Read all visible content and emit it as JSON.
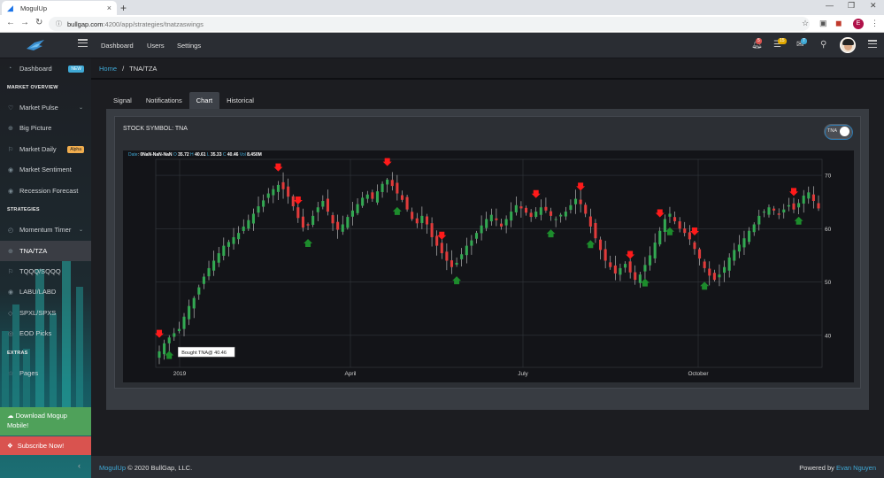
{
  "browser": {
    "tab_title": "MogulUp",
    "close_glyph": "×",
    "new_tab_glyph": "+",
    "url_host": "bullgap.com",
    "url_path": ":4200/app/strategies/tnatzaswings",
    "profile_initial": "E"
  },
  "header": {
    "nav": [
      "Dashboard",
      "Users",
      "Settings"
    ],
    "badges": {
      "notifications": "5",
      "messages": "15",
      "cart": "7"
    },
    "colors": {
      "notifications": "#d9534f",
      "messages": "#e0a800",
      "cart": "#3fa9d6"
    }
  },
  "sidebar": {
    "dashboard": {
      "label": "Dashboard",
      "badge": "NEW"
    },
    "sections": {
      "market_overview": "MARKET OVERVIEW",
      "strategies": "STRATEGIES",
      "extras": "EXTRAS"
    },
    "items": {
      "market_pulse": "Market Pulse",
      "big_picture": "Big Picture",
      "market_daily": "Market Daily",
      "market_daily_badge": "Alpha",
      "market_sentiment": "Market Sentiment",
      "recession_forecast": "Recession Forecast",
      "momentum_timer": "Momentum Timer",
      "tna_tza": "TNA/TZA",
      "tqqq_sqqq": "TQQQ/SQQQ",
      "labu_labd": "LABU/LABD",
      "spxl_spxs": "SPXL/SPXS",
      "eod_picks": "EOD Picks",
      "pages": "Pages"
    },
    "download": "Download Mogup Mobile!",
    "subscribe": "Subscribe Now!"
  },
  "breadcrumb": {
    "home": "Home",
    "sep": "/",
    "current": "TNA/TZA"
  },
  "tabs": [
    "Signal",
    "Notifications",
    "Chart",
    "Historical"
  ],
  "active_tab": "Chart",
  "card": {
    "title": "STOCK SYMBOL: TNA",
    "toggle_label": "TNA",
    "toggle_on": true
  },
  "ohlc": {
    "date_label": "Date",
    "date_value": "0NaN-NaN-NaN",
    "o_label": "O",
    "o_value": "35.72",
    "h_label": "H",
    "h_value": "40.61",
    "l_label": "L",
    "l_value": "35.33",
    "c_label": "C",
    "c_value": "40.46",
    "vol_label": "Vol",
    "vol_value": "8.450M"
  },
  "chart_data": {
    "type": "candlestick",
    "x_ticks": [
      "2019",
      "April",
      "July",
      "October"
    ],
    "y_ticks": [
      40,
      50,
      60,
      70
    ],
    "ylim": [
      34,
      73
    ],
    "grid": true,
    "colors": {
      "up": "#33a852",
      "down": "#e03b3b",
      "buy": "#1d8c2c",
      "sell": "#ff1a1a"
    },
    "tooltip": "Bought TNA@ 40.46",
    "closes": [
      37,
      38.5,
      39.6,
      40.4,
      41.2,
      43.5,
      45.5,
      47,
      49,
      51,
      52.6,
      54,
      55.4,
      56.8,
      57.5,
      58.4,
      59.2,
      60.4,
      61.6,
      62.8,
      64.2,
      65.3,
      66.6,
      67.4,
      68.2,
      67.4,
      66,
      64.2,
      62,
      60.2,
      60.6,
      62.4,
      64,
      65.2,
      63.2,
      61,
      59.8,
      60.8,
      62.2,
      63.4,
      64.6,
      65.8,
      66.4,
      65.6,
      67,
      68.4,
      69.2,
      68,
      66.6,
      65.4,
      63.6,
      61.8,
      61,
      62.4,
      60.8,
      58.4,
      56.8,
      55.4,
      54,
      52.8,
      53.6,
      55.2,
      56.8,
      57.8,
      59.2,
      60.6,
      61.8,
      62.6,
      61.6,
      60.4,
      61.8,
      63.2,
      64.4,
      63.8,
      63,
      62.2,
      63.2,
      64,
      63.4,
      62.4,
      61.8,
      62.6,
      63.2,
      64.4,
      65.6,
      64.6,
      62.8,
      60.4,
      58.2,
      56,
      54,
      52.8,
      51.6,
      52.6,
      53.4,
      51.8,
      50.4,
      51.4,
      53.2,
      55,
      57.4,
      59.6,
      61.8,
      62.8,
      61.4,
      60,
      59.2,
      58,
      56.2,
      54.4,
      52.6,
      51.2,
      50.4,
      51.4,
      52.8,
      54.6,
      56,
      57,
      58.2,
      59.6,
      60.8,
      62.4,
      63.2,
      64,
      63.4,
      62.6,
      63.6,
      64.4,
      63.6,
      64.8,
      66.2,
      66.8,
      65.2,
      63.8
    ],
    "signals": [
      {
        "i": 0,
        "type": "sell"
      },
      {
        "i": 2,
        "type": "buy"
      },
      {
        "i": 24,
        "type": "sell"
      },
      {
        "i": 28,
        "type": "sell"
      },
      {
        "i": 30,
        "type": "buy"
      },
      {
        "i": 46,
        "type": "sell"
      },
      {
        "i": 48,
        "type": "buy"
      },
      {
        "i": 57,
        "type": "sell"
      },
      {
        "i": 60,
        "type": "buy"
      },
      {
        "i": 76,
        "type": "sell"
      },
      {
        "i": 79,
        "type": "buy"
      },
      {
        "i": 85,
        "type": "sell"
      },
      {
        "i": 87,
        "type": "buy"
      },
      {
        "i": 95,
        "type": "sell"
      },
      {
        "i": 98,
        "type": "buy"
      },
      {
        "i": 101,
        "type": "sell"
      },
      {
        "i": 103,
        "type": "buy"
      },
      {
        "i": 108,
        "type": "sell"
      },
      {
        "i": 110,
        "type": "buy"
      },
      {
        "i": 128,
        "type": "sell"
      },
      {
        "i": 129,
        "type": "buy"
      }
    ]
  },
  "footer": {
    "brand": "MogulUp",
    "copyright": "© 2020 BullGap, LLC.",
    "powered_by": "Powered by",
    "author": "Evan Nguyen"
  }
}
